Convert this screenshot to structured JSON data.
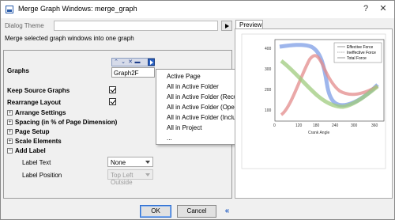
{
  "window": {
    "title": "Merge Graph Windows: merge_graph"
  },
  "dialog_theme": {
    "label": "Dialog Theme",
    "value": ""
  },
  "description": "Merge selected graph windows into one graph",
  "settings": {
    "graphs": {
      "label": "Graphs",
      "value": "Graph2F"
    },
    "keep_source_graphs": {
      "label": "Keep Source Graphs",
      "checked": true
    },
    "rearrange_layout": {
      "label": "Rearrange Layout",
      "checked": true
    },
    "arrange_settings": {
      "label": "Arrange Settings"
    },
    "spacing": {
      "label": "Spacing (in % of Page Dimension)"
    },
    "page_setup": {
      "label": "Page Setup"
    },
    "scale_elements": {
      "label": "Scale Elements"
    },
    "add_label": {
      "label": "Add Label"
    },
    "label_text": {
      "label": "Label Text",
      "value": "None"
    },
    "label_position": {
      "label": "Label Position",
      "value": "Top Left Outside"
    }
  },
  "menu": {
    "items": [
      "Active Page",
      "All in Active Folder",
      "All in Active Folder (Recursive)",
      "All in Active Folder (Open)",
      "All in Active Folder (Include Embedded)",
      "All in Project",
      "..."
    ]
  },
  "preview": {
    "tab": "Preview",
    "chart": {
      "ytick_labels": [
        "400",
        "300",
        "200",
        "100"
      ],
      "xtick_labels": [
        "0",
        "120",
        "180",
        "240",
        "300",
        "360"
      ],
      "xlabel": "Crank Angle",
      "legend": [
        "Effective Force",
        "Ineffective Force",
        "Total Force"
      ],
      "series_colors": [
        "#7d9ee6",
        "#e38b8b",
        "#9fcb7e"
      ]
    }
  },
  "buttons": {
    "ok": "OK",
    "cancel": "Cancel",
    "collapse": "«"
  }
}
